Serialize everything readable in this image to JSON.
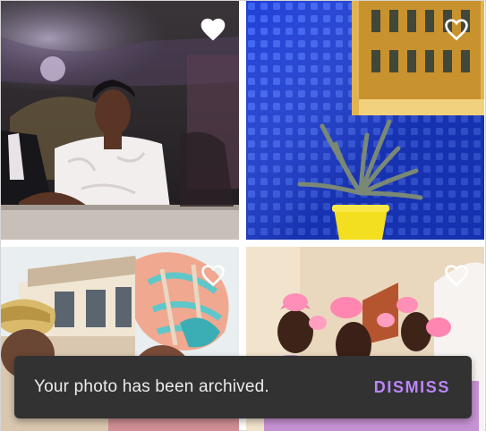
{
  "gallery": {
    "photos": [
      {
        "subject": "wedding-bride",
        "favorited": true
      },
      {
        "subject": "plant-blue-wall",
        "favorited": false
      },
      {
        "subject": "headwrap-woman",
        "favorited": false
      },
      {
        "subject": "bridesmaids-pink",
        "favorited": false
      }
    ]
  },
  "snackbar": {
    "message": "Your photo has been archived.",
    "action_label": "DISMISS",
    "action_color": "#bb86fc",
    "background": "#323232"
  },
  "icons": {
    "favorite_filled": "heart-filled-icon",
    "favorite_outline": "heart-outline-icon"
  }
}
